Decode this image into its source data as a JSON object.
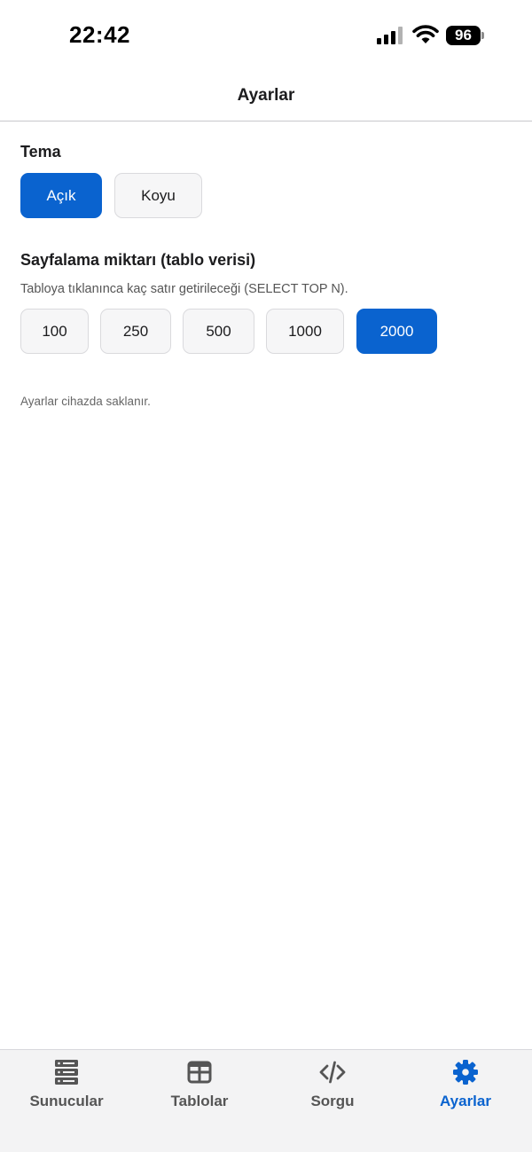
{
  "status_bar": {
    "time": "22:42",
    "battery": "96"
  },
  "nav": {
    "title": "Ayarlar"
  },
  "theme": {
    "title": "Tema",
    "options": [
      "Açık",
      "Koyu"
    ],
    "selected": "Açık"
  },
  "paging": {
    "title": "Sayfalama miktarı (tablo verisi)",
    "description": "Tabloya tıklanınca kaç satır getirileceği (SELECT TOP N).",
    "options": [
      "100",
      "250",
      "500",
      "1000",
      "2000"
    ],
    "selected": "2000"
  },
  "note": "Ayarlar cihazda saklanır.",
  "tab_bar": {
    "items": [
      {
        "label": "Sunucular",
        "icon": "server-icon"
      },
      {
        "label": "Tablolar",
        "icon": "table-grid-icon"
      },
      {
        "label": "Sorgu",
        "icon": "code-icon"
      },
      {
        "label": "Ayarlar",
        "icon": "gear-icon"
      }
    ],
    "active": "Ayarlar"
  },
  "colors": {
    "accent": "#0a63cf",
    "button_bg": "#f6f6f7",
    "tab_bar_bg": "#f3f3f4"
  }
}
